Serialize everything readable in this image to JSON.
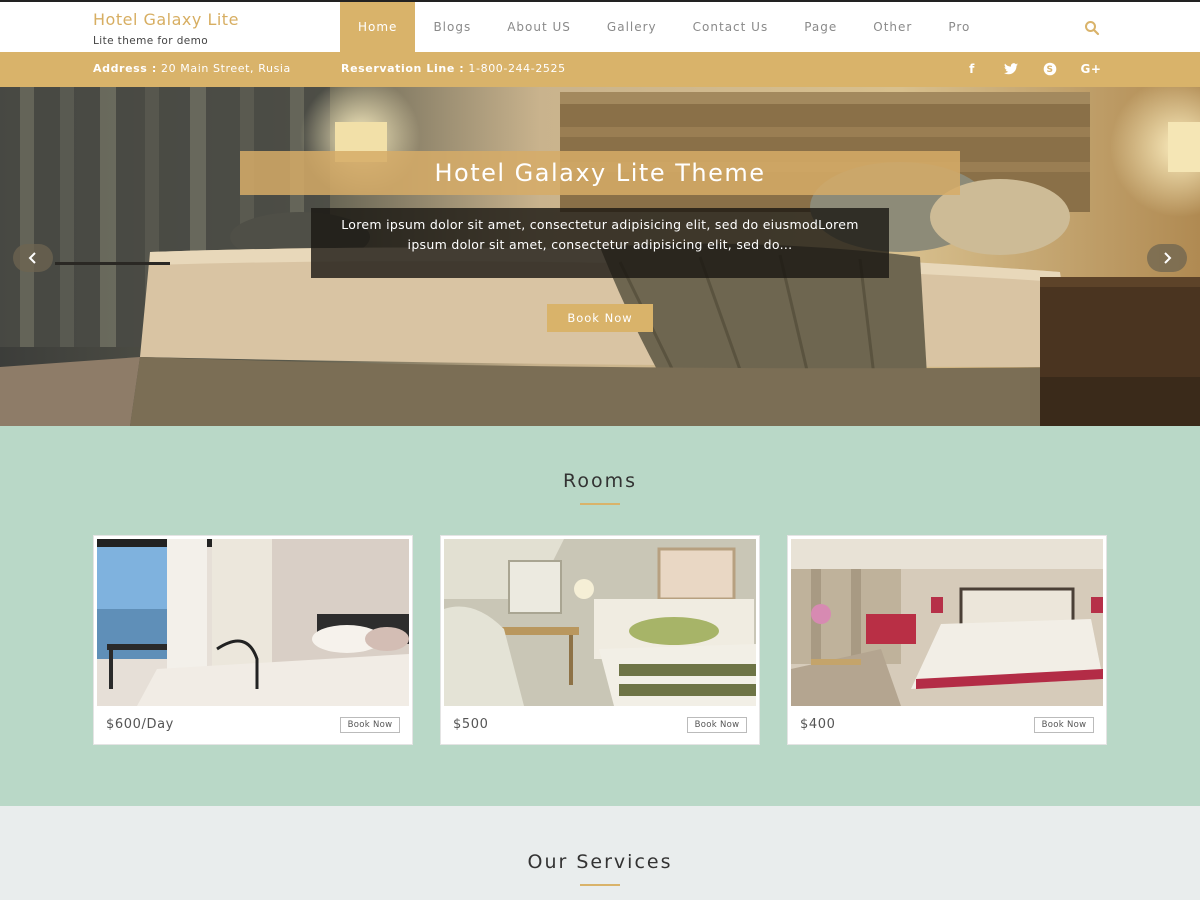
{
  "brand": {
    "title": "Hotel Galaxy Lite",
    "tagline": "Lite theme for demo",
    "accent": "#d9b36a"
  },
  "nav": {
    "items": [
      {
        "label": "Home",
        "active": true
      },
      {
        "label": "Blogs"
      },
      {
        "label": "About US"
      },
      {
        "label": "Gallery"
      },
      {
        "label": "Contact Us"
      },
      {
        "label": "Page"
      },
      {
        "label": "Other"
      },
      {
        "label": "Pro"
      }
    ],
    "search_icon": "search-icon"
  },
  "infobar": {
    "address_label": "Address :",
    "address_value": "20 Main Street, Rusia",
    "reservation_label": "Reservation Line :",
    "reservation_value": "1-800-244-2525",
    "social": [
      {
        "icon": "facebook-icon",
        "glyph": "f"
      },
      {
        "icon": "twitter-icon",
        "glyph": "t"
      },
      {
        "icon": "skype-icon",
        "glyph": "S"
      },
      {
        "icon": "google-plus-icon",
        "glyph": "G+"
      }
    ]
  },
  "hero": {
    "title": "Hotel Galaxy Lite Theme",
    "description": "Lorem ipsum dolor sit amet, consectetur adipisicing elit, sed do eiusmodLorem ipsum dolor sit amet, consectetur adipisicing elit, sed do...",
    "button": "Book Now",
    "prev_icon": "chevron-left-icon",
    "next_icon": "chevron-right-icon"
  },
  "rooms": {
    "title": "Rooms",
    "cards": [
      {
        "price": "$600/Day",
        "button": "Book Now"
      },
      {
        "price": "$500",
        "button": "Book Now"
      },
      {
        "price": "$400",
        "button": "Book Now"
      }
    ]
  },
  "services": {
    "title": "Our Services"
  }
}
